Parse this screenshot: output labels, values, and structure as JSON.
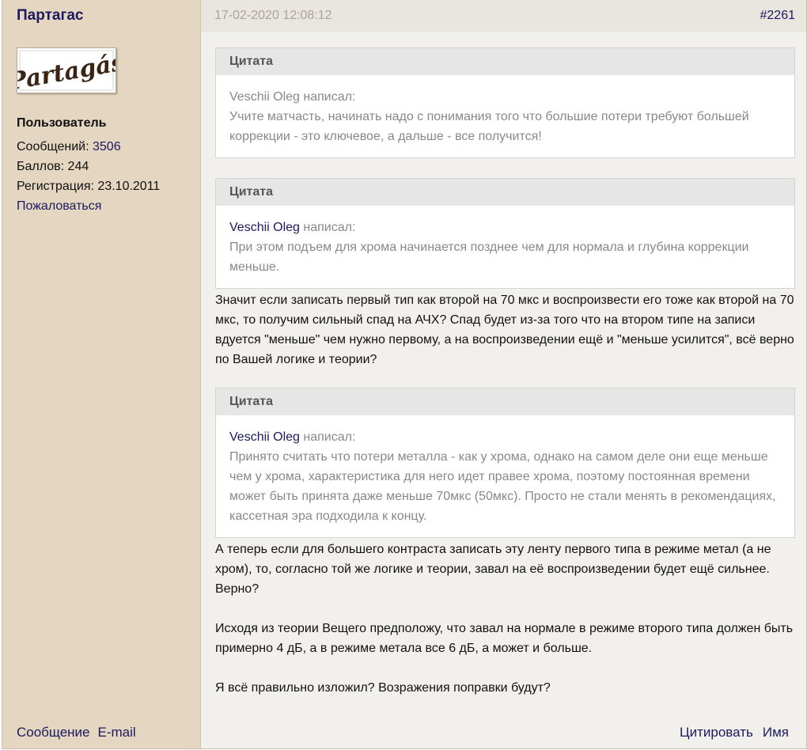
{
  "author": {
    "name": "Партагас",
    "avatar_text": "Partagás",
    "role": "Пользователь",
    "messages_label": "Сообщений: ",
    "messages_count": "3506",
    "points_label": "Баллов: 244",
    "registration_label": "Регистрация: 23.10.2011",
    "report_link": "Пожаловаться",
    "footer_links": [
      "Сообщение",
      "E-mail"
    ]
  },
  "post": {
    "date": "17-02-2020 12:08:12",
    "number": "#2261",
    "quote_header": "Цитата",
    "quotes": [
      {
        "author": "Veschii Oleg",
        "wrote": " написал:",
        "text": "Учите матчасть, начинать надо с понимания того что большие потери требуют большей коррекции - это ключевое, а дальше - все получится!"
      },
      {
        "author": "Veschii Oleg",
        "wrote": " написал:",
        "text": "При этом подъем для хрома начинается позднее чем для нормала и глубина коррекции меньше."
      },
      {
        "author": "Veschii Oleg",
        "wrote": " написал:",
        "text": "Принято считать что потери металла - как у хрома, однако на самом деле они еще меньше чем у хрома, характеристика для него идет правее хрома, поэтому постоянная времени может быть принята даже меньше 70мкс (50мкс). Просто не стали менять в рекомендациях, кассетная эра подходила к концу."
      }
    ],
    "paragraphs": [
      "Значит если записать первый тип как второй на 70 мкс и воспроизвести его тоже как второй на 70 мкс, то получим сильный спад на АЧХ? Спад будет из-за того что на втором типе на записи вдуется \"меньше\" чем нужно первому, а на воспроизведении ещё и \"меньше усилится\", всё верно по Вашей логике и теории?",
      "А теперь если для большего контраста записать эту ленту первого типа в режиме метал (а не хром), то, согласно той же логике и теории, завал на её воспроизведении будет ещё сильнее. Верно?",
      "Исходя из теории Вещего предположу, что завал на нормале в режиме второго типа должен быть примерно 4 дБ, а в режиме метала все 6 дБ, а может и больше.",
      "Я всё правильно изложил? Возражения поправки будут?"
    ],
    "footer_links": [
      "Цитировать",
      "Имя"
    ]
  }
}
